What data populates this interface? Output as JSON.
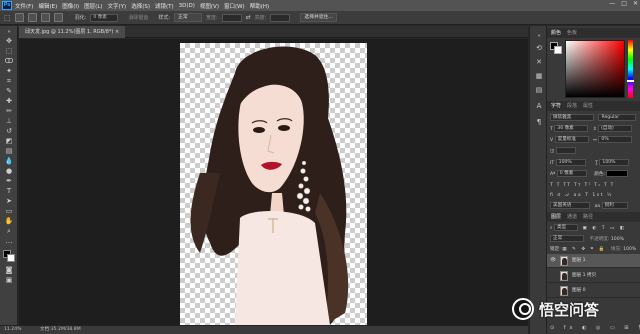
{
  "menubar": {
    "logo": "Ps",
    "items": [
      "文件(F)",
      "编辑(E)",
      "图像(I)",
      "图层(L)",
      "文字(Y)",
      "选择(S)",
      "滤镜(T)",
      "3D(D)",
      "视图(V)",
      "窗口(W)",
      "帮助(H)"
    ],
    "window_controls": [
      "—",
      "□",
      "✕"
    ]
  },
  "options": {
    "feather_label": "羽化:",
    "feather_value": "0 像素",
    "anti_alias": "消除锯齿",
    "style_label": "样式:",
    "style_value": "正常",
    "width_label": "宽度:",
    "height_label": "高度:",
    "refine_edge": "选择并遮住..."
  },
  "document": {
    "tab_title": "邱天发.jpg @ 11.2%(图层 1, RGB/8*) ×"
  },
  "status": {
    "zoom": "11.24%",
    "doc_info": "文档:35.2M/38.8M"
  },
  "color_panel": {
    "tab1": "颜色",
    "tab2": "色板",
    "hue_color": "#ff0000"
  },
  "character_panel": {
    "tabs": [
      "字符",
      "段落",
      "属性"
    ],
    "font_family": "微软雅黑",
    "font_style": "Regular",
    "size": "36 像素",
    "leading": "(自动)",
    "kerning": "度量标准",
    "tracking": "0%",
    "vscale": "100%",
    "hscale": "100%",
    "baseline": "0 像素",
    "color_label": "颜色:",
    "language": "美国英语",
    "anti_alias": "锐利"
  },
  "layers_panel": {
    "tabs": [
      "图层",
      "通道",
      "路径"
    ],
    "filter": "类型",
    "blend_mode": "正常",
    "opacity_label": "不透明度:",
    "opacity": "100%",
    "lock_label": "锁定:",
    "fill_label": "填充:",
    "fill": "100%",
    "layers": [
      {
        "name": "图层 1",
        "selected": true
      },
      {
        "name": "图层 1 拷贝",
        "selected": false
      },
      {
        "name": "图层 0",
        "selected": false
      }
    ]
  },
  "watermark": {
    "text": "悟空问答"
  }
}
